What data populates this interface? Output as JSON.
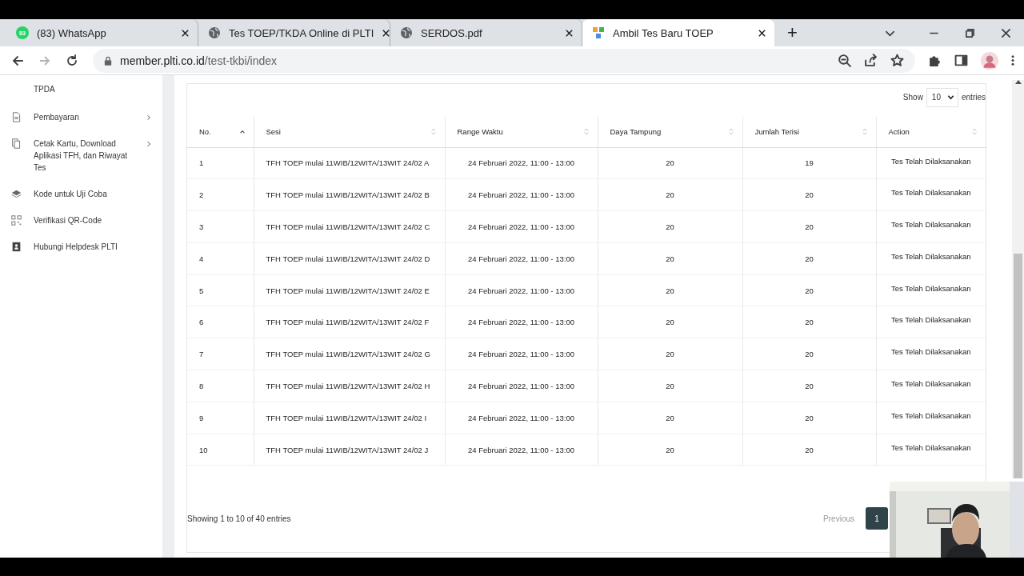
{
  "browser": {
    "tabs": [
      {
        "title": "(83) WhatsApp",
        "kind": "whatsapp",
        "badge": "83",
        "selected": false
      },
      {
        "title": "Tes TOEP/TKDA Online di PLTI",
        "kind": "globe",
        "selected": false
      },
      {
        "title": "SERDOS.pdf",
        "kind": "globe",
        "selected": false
      },
      {
        "title": "Ambil Tes Baru TOEP",
        "kind": "tiles",
        "selected": true
      }
    ],
    "new_tab": "+",
    "url_host": "member.plti.co.id",
    "url_path": "/test-tkbi/index"
  },
  "sidebar": {
    "items": [
      {
        "label": "TPDA",
        "kind": "plain",
        "has_submenu": false
      },
      {
        "label": "Pembayaran",
        "kind": "document",
        "has_submenu": true
      },
      {
        "label": "Cetak Kartu, Download Aplikasi TFH, dan Riwayat Tes",
        "kind": "copy",
        "has_submenu": true
      },
      {
        "label": "Kode untuk Uji Coba",
        "kind": "layers",
        "has_submenu": false
      },
      {
        "label": "Verifikasi QR-Code",
        "kind": "qr",
        "has_submenu": false
      },
      {
        "label": "Hubungi Helpdesk PLTI",
        "kind": "contact",
        "has_submenu": false
      }
    ]
  },
  "table": {
    "length_label": "Show",
    "length_value": "10",
    "length_suffix": "entries",
    "columns": [
      {
        "label": "No.",
        "sorted": true
      },
      {
        "label": "Sesi",
        "sorted": false
      },
      {
        "label": "Range Waktu",
        "sorted": false
      },
      {
        "label": "Daya Tampung",
        "sorted": false
      },
      {
        "label": "Jumlah Terisi",
        "sorted": false
      },
      {
        "label": "Action",
        "sorted": false
      }
    ],
    "rows": [
      [
        "1",
        "TFH TOEP mulai 11WIB/12WITA/13WIT 24/02 A",
        "24 Februari 2022, 11:00 - 13:00",
        "20",
        "19",
        "Tes Telah Dilaksanakan"
      ],
      [
        "2",
        "TFH TOEP mulai 11WIB/12WITA/13WIT 24/02 B",
        "24 Februari 2022, 11:00 - 13:00",
        "20",
        "20",
        "Tes Telah Dilaksanakan"
      ],
      [
        "3",
        "TFH TOEP mulai 11WIB/12WITA/13WIT 24/02 C",
        "24 Februari 2022, 11:00 - 13:00",
        "20",
        "20",
        "Tes Telah Dilaksanakan"
      ],
      [
        "4",
        "TFH TOEP mulai 11WIB/12WITA/13WIT 24/02 D",
        "24 Februari 2022, 11:00 - 13:00",
        "20",
        "20",
        "Tes Telah Dilaksanakan"
      ],
      [
        "5",
        "TFH TOEP mulai 11WIB/12WITA/13WIT 24/02 E",
        "24 Februari 2022, 11:00 - 13:00",
        "20",
        "20",
        "Tes Telah Dilaksanakan"
      ],
      [
        "6",
        "TFH TOEP mulai 11WIB/12WITA/13WIT 24/02 F",
        "24 Februari 2022, 11:00 - 13:00",
        "20",
        "20",
        "Tes Telah Dilaksanakan"
      ],
      [
        "7",
        "TFH TOEP mulai 11WIB/12WITA/13WIT 24/02 G",
        "24 Februari 2022, 11:00 - 13:00",
        "20",
        "20",
        "Tes Telah Dilaksanakan"
      ],
      [
        "8",
        "TFH TOEP mulai 11WIB/12WITA/13WIT 24/02 H",
        "24 Februari 2022, 11:00 - 13:00",
        "20",
        "20",
        "Tes Telah Dilaksanakan"
      ],
      [
        "9",
        "TFH TOEP mulai 11WIB/12WITA/13WIT 24/02 I",
        "24 Februari 2022, 11:00 - 13:00",
        "20",
        "20",
        "Tes Telah Dilaksanakan"
      ],
      [
        "10",
        "TFH TOEP mulai 11WIB/12WITA/13WIT 24/02 J",
        "24 Februari 2022, 11:00 - 13:00",
        "20",
        "20",
        "Tes Telah Dilaksanakan"
      ]
    ],
    "info": "Showing 1 to 10 of 40 entries",
    "pagination": {
      "previous": "Previous",
      "pages": [
        {
          "label": "1",
          "selected": true
        }
      ]
    }
  }
}
